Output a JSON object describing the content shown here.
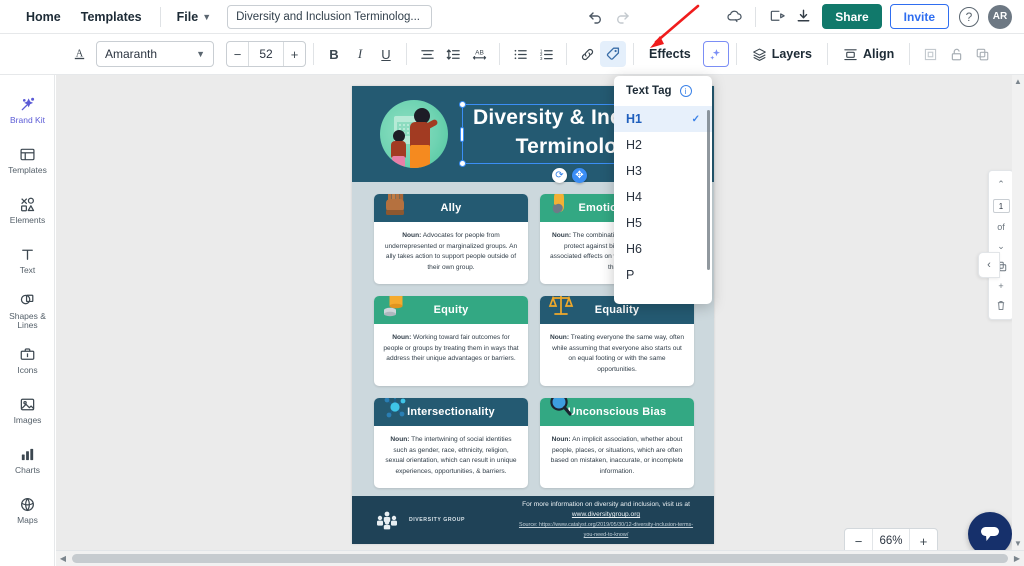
{
  "topbar": {
    "home": "Home",
    "templates": "Templates",
    "file": "File",
    "doc_title": "Diversity and Inclusion Terminolog...",
    "undo_icon": "undo-icon",
    "redo_icon": "redo-icon",
    "cloud_icon": "cloud-save-icon",
    "present_icon": "present-icon",
    "download_icon": "download-icon",
    "share": "Share",
    "invite": "Invite",
    "help": "?",
    "avatar": "AR"
  },
  "toolbar": {
    "text_color_icon": "text-color-icon",
    "font_family": "Amaranth",
    "font_size": "52",
    "minus": "−",
    "plus": "+",
    "bold": "B",
    "italic": "I",
    "underline": "U",
    "align_icon": "align-icon",
    "line_spacing_icon": "line-spacing-icon",
    "letter_spacing_icon": "letter-spacing-icon",
    "bullet_list_icon": "bullet-list-icon",
    "numbered_list_icon": "numbered-list-icon",
    "link_icon": "link-icon",
    "tag_icon": "text-tag-icon",
    "effects": "Effects",
    "ai_icon": "ai-sparkle-icon",
    "layers": "Layers",
    "align": "Align",
    "crop_icon": "crop-icon",
    "lock_icon": "lock-icon",
    "duplicate_icon": "duplicate-icon"
  },
  "rail": {
    "items": [
      {
        "label": "Brand Kit",
        "icon": "magic-wand-icon",
        "active": true
      },
      {
        "label": "Templates",
        "icon": "templates-icon",
        "active": false
      },
      {
        "label": "Elements",
        "icon": "elements-icon",
        "active": false
      },
      {
        "label": "Text",
        "icon": "text-icon",
        "active": false
      },
      {
        "label": "Shapes & Lines",
        "icon": "shapes-icon",
        "active": false
      },
      {
        "label": "Icons",
        "icon": "icons-icon",
        "active": false
      },
      {
        "label": "Images",
        "icon": "images-icon",
        "active": false
      },
      {
        "label": "Charts",
        "icon": "charts-icon",
        "active": false
      },
      {
        "label": "Maps",
        "icon": "maps-icon",
        "active": false
      }
    ]
  },
  "text_tag": {
    "title": "Text Tag",
    "info_icon": "info-icon",
    "options": [
      "H1",
      "H2",
      "H3",
      "H4",
      "H5",
      "H6",
      "P"
    ],
    "selected": "H1",
    "check": "✓"
  },
  "canvas": {
    "zoom": "66%",
    "zoom_out": "−",
    "zoom_in": "+",
    "collapse_icon": "chevron-left-icon",
    "chat_icon": "chat-bubble-icon",
    "right_panel": {
      "page_number": "1",
      "of_label": "of",
      "duplicate_icon": "duplicate-page-icon",
      "add_icon": "add-page-icon",
      "delete_icon": "delete-page-icon",
      "up_icon": "chevron-up-icon",
      "down_icon": "chevron-down-icon"
    }
  },
  "infographic": {
    "title_line1": "Diversity & Inclusion",
    "title_line2": "Terminology",
    "cards": [
      {
        "term": "Ally",
        "icon": "raised-fist-icon",
        "header_color": "#245a72",
        "noun_label": "Noun:",
        "definition": " Advocates for people from underrepresented or marginalized groups. An ally takes action to support people outside of their own group."
      },
      {
        "term": "Emotional Tax",
        "icon": "hand-icon",
        "header_color": "#33a883",
        "noun_label": "Noun:",
        "definition": " The combination of being on guard to protect against bias at work, and the associated effects on well-being, and ability to thrive."
      },
      {
        "term": "Equity",
        "icon": "coins-icon",
        "header_color": "#33a883",
        "noun_label": "Noun:",
        "definition": " Working toward fair outcomes for people or groups by treating them in ways that address their unique advantages or barriers."
      },
      {
        "term": "Equality",
        "icon": "scales-icon",
        "header_color": "#245a72",
        "noun_label": "Noun:",
        "definition": " Treating everyone the same way, often while assuming that everyone also starts out on equal footing or with the same opportunities."
      },
      {
        "term": "Intersectionality",
        "icon": "network-node-icon",
        "header_color": "#245a72",
        "noun_label": "Noun:",
        "definition": " The intertwining of social identities such as gender, race, ethnicity, religion, sexual orientation, which can result in unique experiences, opportunities, & barriers."
      },
      {
        "term": "Unconscious Bias",
        "icon": "magnifier-icon",
        "header_color": "#33a883",
        "noun_label": "Noun:",
        "definition": " An implicit association, whether about people, places, or situations, which are often based on mistaken, inaccurate, or incomplete information."
      }
    ],
    "footer": {
      "logo_icon": "people-group-icon",
      "brand": "DIVERSITY GROUP",
      "info_prefix": "For more information on diversity and inclusion, visit us at ",
      "info_link": "www.diversitygroup.org",
      "source": "Source: https://www.catalyst.org/2019/05/30/12-diversity-inclusion-terms-you-need-to-know/"
    }
  },
  "annotation": {
    "arrow_icon": "red-arrow-annotation",
    "color": "#f01c1c"
  }
}
